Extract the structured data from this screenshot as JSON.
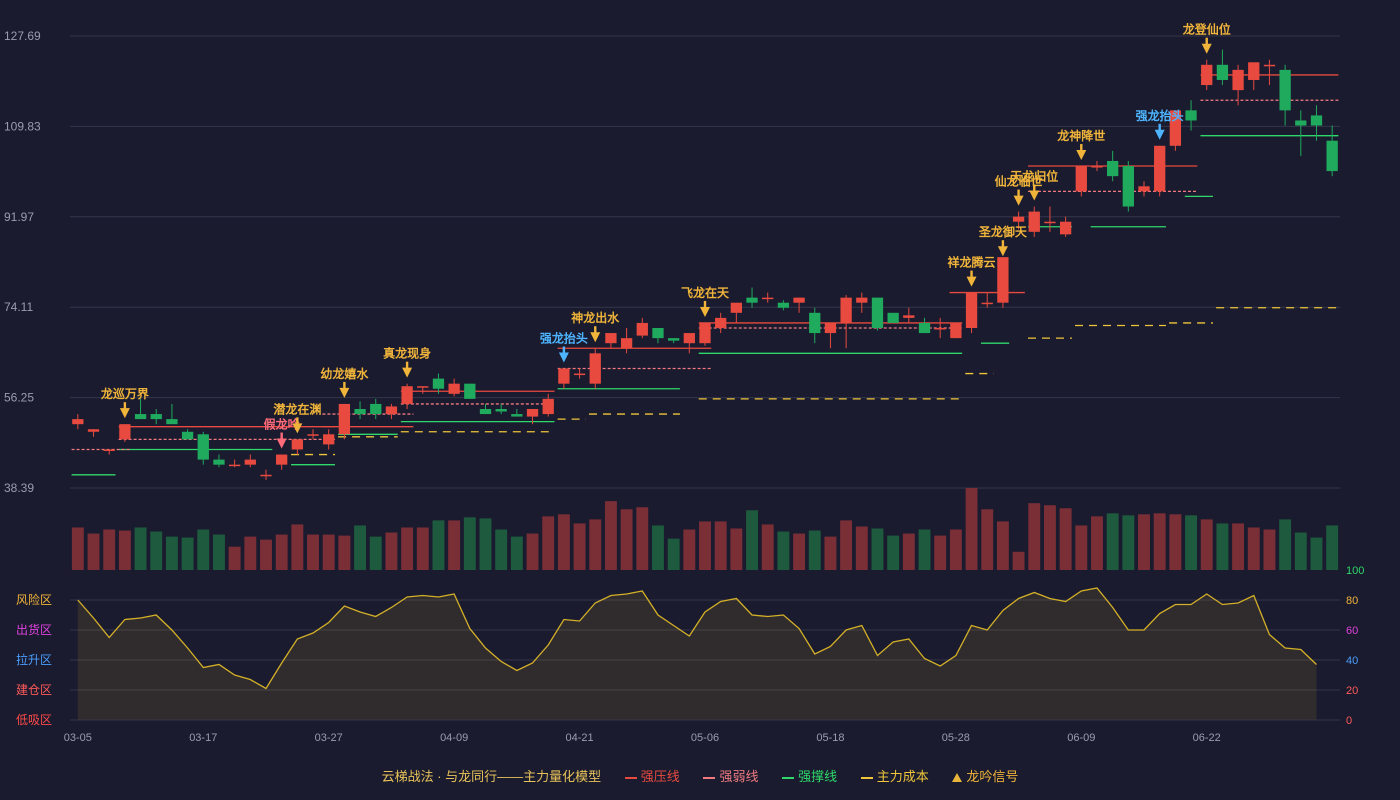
{
  "colors": {
    "background": "#1a1b2e",
    "up": "#e84a3f",
    "down": "#1faa5e",
    "pressure": "#e84a3f",
    "weak": "#f07a80",
    "support": "#2fd86a",
    "cost": "#f0c53a",
    "signal": "#f0b43a",
    "signal_blue": "#4db4ff",
    "osc_line": "#d4b028",
    "grid": "#34364b",
    "axis_text": "#9a9cb0"
  },
  "chart_data": {
    "type": "candlestick",
    "y_axis": {
      "range": [
        38.39,
        127.69
      ],
      "ticks": [
        "127.69",
        "109.83",
        "91.97",
        "74.11",
        "56.25",
        "38.39"
      ]
    },
    "x_tick_labels": [
      "03-05",
      "03-17",
      "03-27",
      "04-09",
      "04-21",
      "05-06",
      "05-18",
      "05-28",
      "06-09",
      "06-22"
    ],
    "x_tick_index": [
      0,
      8,
      16,
      24,
      32,
      40,
      48,
      56,
      64,
      72
    ],
    "candles": [
      [
        51,
        53,
        50,
        52
      ],
      [
        49.5,
        50,
        48.5,
        50
      ],
      [
        46,
        46,
        45,
        46
      ],
      [
        48,
        51,
        47.5,
        51
      ],
      [
        53,
        56,
        52,
        52
      ],
      [
        53,
        54,
        51,
        52
      ],
      [
        52,
        55,
        51.5,
        51
      ],
      [
        49.5,
        50,
        48.5,
        48
      ],
      [
        49,
        49.5,
        43,
        44
      ],
      [
        44,
        45,
        42.5,
        43
      ],
      [
        43,
        44,
        42.5,
        43
      ],
      [
        43,
        45,
        42.5,
        44
      ],
      [
        41,
        42,
        40,
        41
      ],
      [
        43,
        45,
        42,
        45
      ],
      [
        46,
        48,
        45,
        48
      ],
      [
        49,
        50,
        48,
        49
      ],
      [
        47,
        50,
        46,
        49
      ],
      [
        49,
        55,
        48,
        55
      ],
      [
        54,
        55.5,
        52,
        53
      ],
      [
        55,
        56,
        52,
        53
      ],
      [
        53,
        55,
        52,
        54.5
      ],
      [
        55,
        59,
        54,
        58.5
      ],
      [
        58.5,
        58.5,
        57,
        58.5
      ],
      [
        60,
        61,
        57,
        58
      ],
      [
        57,
        60,
        56.5,
        59
      ],
      [
        59,
        59,
        56,
        56
      ],
      [
        54,
        55,
        53,
        53
      ],
      [
        54,
        55,
        53,
        53.5
      ],
      [
        53,
        54,
        52.5,
        52.5
      ],
      [
        52.5,
        54,
        51,
        54
      ],
      [
        53,
        57,
        52.5,
        56
      ],
      [
        59,
        62,
        58,
        62
      ],
      [
        61,
        62,
        60,
        61
      ],
      [
        59,
        66,
        58,
        65
      ],
      [
        67,
        68.5,
        66,
        69
      ],
      [
        66,
        70,
        65,
        68
      ],
      [
        68.5,
        72,
        68,
        71
      ],
      [
        70,
        70,
        67,
        68
      ],
      [
        68,
        68,
        67,
        67.5
      ],
      [
        67,
        68,
        65,
        69
      ],
      [
        67,
        71,
        66.5,
        71
      ],
      [
        70,
        73,
        69,
        72
      ],
      [
        73,
        74,
        71,
        75
      ],
      [
        76,
        78,
        74,
        75
      ],
      [
        76,
        77,
        75,
        76
      ],
      [
        75,
        75.5,
        73.5,
        74
      ],
      [
        75,
        76,
        73,
        76
      ],
      [
        73,
        74,
        67,
        69
      ],
      [
        69,
        71,
        66,
        71
      ],
      [
        71,
        76.5,
        66,
        76
      ],
      [
        75,
        77,
        73,
        76
      ],
      [
        76,
        76,
        69.5,
        70
      ],
      [
        73,
        73,
        71,
        71
      ],
      [
        72,
        74,
        71,
        72.5
      ],
      [
        71,
        72,
        69,
        69
      ],
      [
        70,
        72,
        68,
        70
      ],
      [
        68,
        71,
        68,
        71
      ],
      [
        70,
        77,
        69,
        77
      ],
      [
        75,
        77,
        74,
        75
      ],
      [
        75,
        83,
        74,
        84
      ],
      [
        91,
        93,
        89.5,
        92
      ],
      [
        89,
        94,
        88,
        93
      ],
      [
        91,
        94,
        89,
        91
      ],
      [
        88.5,
        92,
        88,
        91
      ],
      [
        97,
        102,
        96,
        102
      ],
      [
        102,
        103,
        101,
        102
      ],
      [
        103,
        105,
        99,
        100
      ],
      [
        102,
        103,
        93,
        94
      ],
      [
        97,
        99,
        96,
        98
      ],
      [
        97,
        106,
        96,
        106
      ],
      [
        106,
        112,
        105,
        113
      ],
      [
        113,
        115,
        109,
        111
      ],
      [
        118,
        123,
        117,
        122
      ],
      [
        122,
        125,
        118,
        119
      ],
      [
        117,
        122,
        114,
        121
      ],
      [
        119,
        121,
        117,
        122.5
      ],
      [
        122,
        123,
        118,
        122
      ],
      [
        121,
        122,
        110,
        113
      ],
      [
        111,
        113,
        104,
        110
      ],
      [
        112,
        114,
        107,
        110
      ],
      [
        107,
        110,
        100,
        101
      ]
    ],
    "resistance_segments": [
      [
        3,
        16,
        50.5
      ],
      [
        16,
        21,
        50.5
      ],
      [
        21,
        30,
        57.5
      ],
      [
        31,
        40,
        66
      ],
      [
        40,
        56,
        71
      ],
      [
        56,
        60,
        77
      ],
      [
        61,
        71,
        102
      ],
      [
        72,
        80,
        120
      ]
    ],
    "weak_segments": [
      [
        0,
        3,
        46
      ],
      [
        3,
        16,
        48
      ],
      [
        16,
        21,
        53
      ],
      [
        21,
        30,
        55
      ],
      [
        31,
        40,
        62
      ],
      [
        40,
        56,
        70
      ],
      [
        61,
        71,
        97
      ],
      [
        72,
        80,
        115
      ]
    ],
    "support_segments": [
      [
        0,
        2,
        41
      ],
      [
        3,
        12,
        46
      ],
      [
        14,
        16,
        43
      ],
      [
        17,
        20,
        49
      ],
      [
        21,
        30,
        51.5
      ],
      [
        31,
        38,
        58
      ],
      [
        40,
        56,
        65
      ],
      [
        58,
        59,
        67
      ],
      [
        61,
        63,
        90
      ],
      [
        65,
        69,
        90
      ],
      [
        71,
        72,
        96
      ],
      [
        72,
        80,
        108
      ]
    ],
    "cost_segments": [
      [
        14,
        16,
        45
      ],
      [
        17,
        20,
        48.5
      ],
      [
        21,
        30,
        49.5
      ],
      [
        31,
        32,
        52
      ],
      [
        33,
        38,
        53
      ],
      [
        40,
        56,
        56
      ],
      [
        57,
        58,
        61
      ],
      [
        61,
        63,
        68
      ],
      [
        64,
        69,
        70.5
      ],
      [
        70,
        72,
        71
      ],
      [
        73,
        80,
        74
      ]
    ],
    "signals": [
      {
        "i": 3,
        "label": "龙巡万界",
        "color": "yellow"
      },
      {
        "i": 13,
        "label": "假龙吟",
        "color": "pink"
      },
      {
        "i": 14,
        "label": "潜龙在渊",
        "color": "yellow"
      },
      {
        "i": 17,
        "label": "幼龙嬉水",
        "color": "yellow"
      },
      {
        "i": 21,
        "label": "真龙现身",
        "color": "yellow"
      },
      {
        "i": 31,
        "label": "强龙抬头",
        "color": "blue"
      },
      {
        "i": 33,
        "label": "神龙出水",
        "color": "yellow"
      },
      {
        "i": 40,
        "label": "飞龙在天",
        "color": "yellow"
      },
      {
        "i": 57,
        "label": "祥龙腾云",
        "color": "yellow"
      },
      {
        "i": 59,
        "label": "圣龙御天",
        "color": "yellow"
      },
      {
        "i": 60,
        "label": "仙龙临世",
        "color": "yellow"
      },
      {
        "i": 61,
        "label": "天龙归位",
        "color": "yellow"
      },
      {
        "i": 64,
        "label": "龙神降世",
        "color": "yellow"
      },
      {
        "i": 69,
        "label": "强龙抬头",
        "color": "blue"
      },
      {
        "i": 72,
        "label": "龙登仙位",
        "color": "yellow"
      }
    ],
    "volume": [
      42,
      36,
      40,
      39,
      42,
      38,
      33,
      32,
      40,
      35,
      23,
      33,
      30,
      35,
      45,
      35,
      35,
      34,
      44,
      33,
      37,
      42,
      42,
      49,
      49,
      52,
      51,
      40,
      33,
      36,
      53,
      55,
      46,
      50,
      68,
      60,
      62,
      44,
      31,
      40,
      48,
      48,
      41,
      59,
      45,
      38,
      36,
      39,
      33,
      49,
      43,
      41,
      34,
      36,
      40,
      34,
      40,
      81,
      60,
      48,
      18,
      66,
      64,
      61,
      44,
      53,
      56,
      54,
      55,
      56,
      55,
      54,
      50,
      46,
      46,
      42,
      40,
      50,
      37,
      32,
      44
    ],
    "oscillator": [
      80,
      68,
      55,
      67,
      68,
      70,
      60,
      48,
      35,
      37,
      30,
      27,
      21,
      38,
      54,
      58,
      65,
      76,
      72,
      69,
      75,
      82,
      83,
      82,
      84,
      61,
      48,
      39,
      33,
      38,
      50,
      67,
      66,
      78,
      83,
      84,
      86,
      70,
      63,
      56,
      72,
      79,
      81,
      70,
      69,
      70,
      61,
      44,
      49,
      60,
      63,
      43,
      52,
      54,
      41,
      36,
      43,
      63,
      60,
      73,
      81,
      85,
      81,
      79,
      86,
      88,
      75,
      60,
      60,
      71,
      77,
      77,
      84,
      77,
      78,
      83,
      57,
      48,
      47,
      37
    ],
    "oscillator_axis": {
      "range": [
        0,
        100
      ],
      "ticks": [
        0,
        20,
        40,
        60,
        80,
        100
      ]
    },
    "oscillator_zones": [
      {
        "label": "风险区",
        "color": "#f0b43a"
      },
      {
        "label": "出货区",
        "color": "#e040e0"
      },
      {
        "label": "拉升区",
        "color": "#4a9eff"
      },
      {
        "label": "建仓区",
        "color": "#ff5a5a"
      },
      {
        "label": "低吸区",
        "color": "#ff4a4a"
      }
    ]
  },
  "legend": {
    "title": "云梯战法 · 与龙同行——主力量化模型",
    "items": [
      {
        "label": "强压线",
        "color": "#e84a3f",
        "style": "solid"
      },
      {
        "label": "强弱线",
        "color": "#f07a80",
        "style": "dashed"
      },
      {
        "label": "强撑线",
        "color": "#2fd86a",
        "style": "solid"
      },
      {
        "label": "主力成本",
        "color": "#f0c53a",
        "style": "dashed"
      },
      {
        "label": "龙吟信号",
        "color": "#f0b43a",
        "style": "triangle"
      }
    ]
  }
}
